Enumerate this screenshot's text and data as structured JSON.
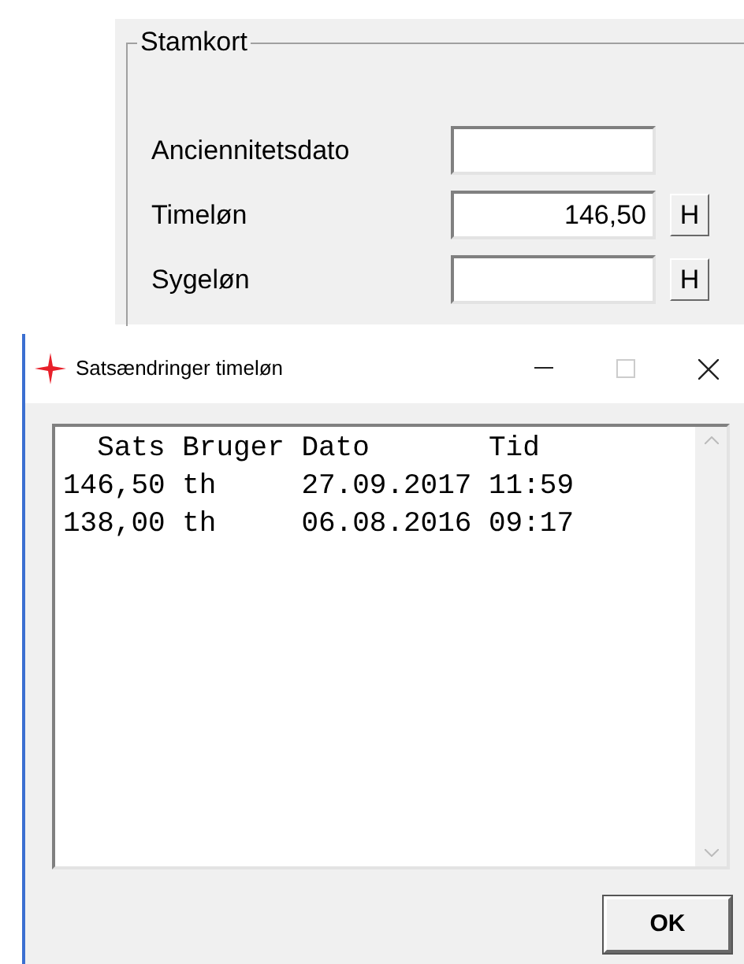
{
  "group": {
    "title": "Stamkort",
    "fields": [
      {
        "label": "Anciennitetsdato"
      },
      {
        "label": "Timeløn",
        "value": "146,50",
        "button": "H"
      },
      {
        "label": "Sygeløn",
        "button": "H"
      }
    ]
  },
  "dialog": {
    "title": "Satsændringer timeløn",
    "columns": [
      "Sats",
      "Bruger",
      "Dato",
      "Tid"
    ],
    "rows": [
      [
        "146,50",
        "th",
        "27.09.2017",
        "11:59"
      ],
      [
        "138,00",
        "th",
        "06.08.2016",
        "09:17"
      ]
    ],
    "ok_button": "OK"
  }
}
